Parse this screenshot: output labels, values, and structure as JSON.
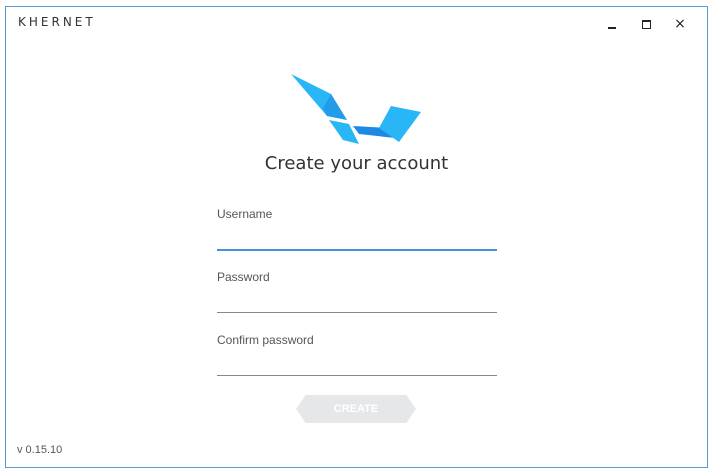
{
  "app": {
    "brand": "KHERNET",
    "version": "v 0.15.10"
  },
  "window_controls": {
    "minimize": "minimize",
    "maximize": "maximize",
    "close": "×"
  },
  "form": {
    "title": "Create your account",
    "username_label": "Username",
    "username_value": "",
    "password_label": "Password",
    "password_value": "",
    "confirm_label": "Confirm password",
    "confirm_value": "",
    "create_label": "CREATE"
  },
  "colors": {
    "accent": "#4a90d9",
    "logo_light": "#29b6f6",
    "logo_dark": "#1e88e5",
    "button_disabled": "#e6e7e8"
  },
  "icons": {
    "logo": "khernet-bird-logo",
    "minimize": "minimize-icon",
    "maximize": "maximize-icon",
    "close": "close-icon"
  }
}
